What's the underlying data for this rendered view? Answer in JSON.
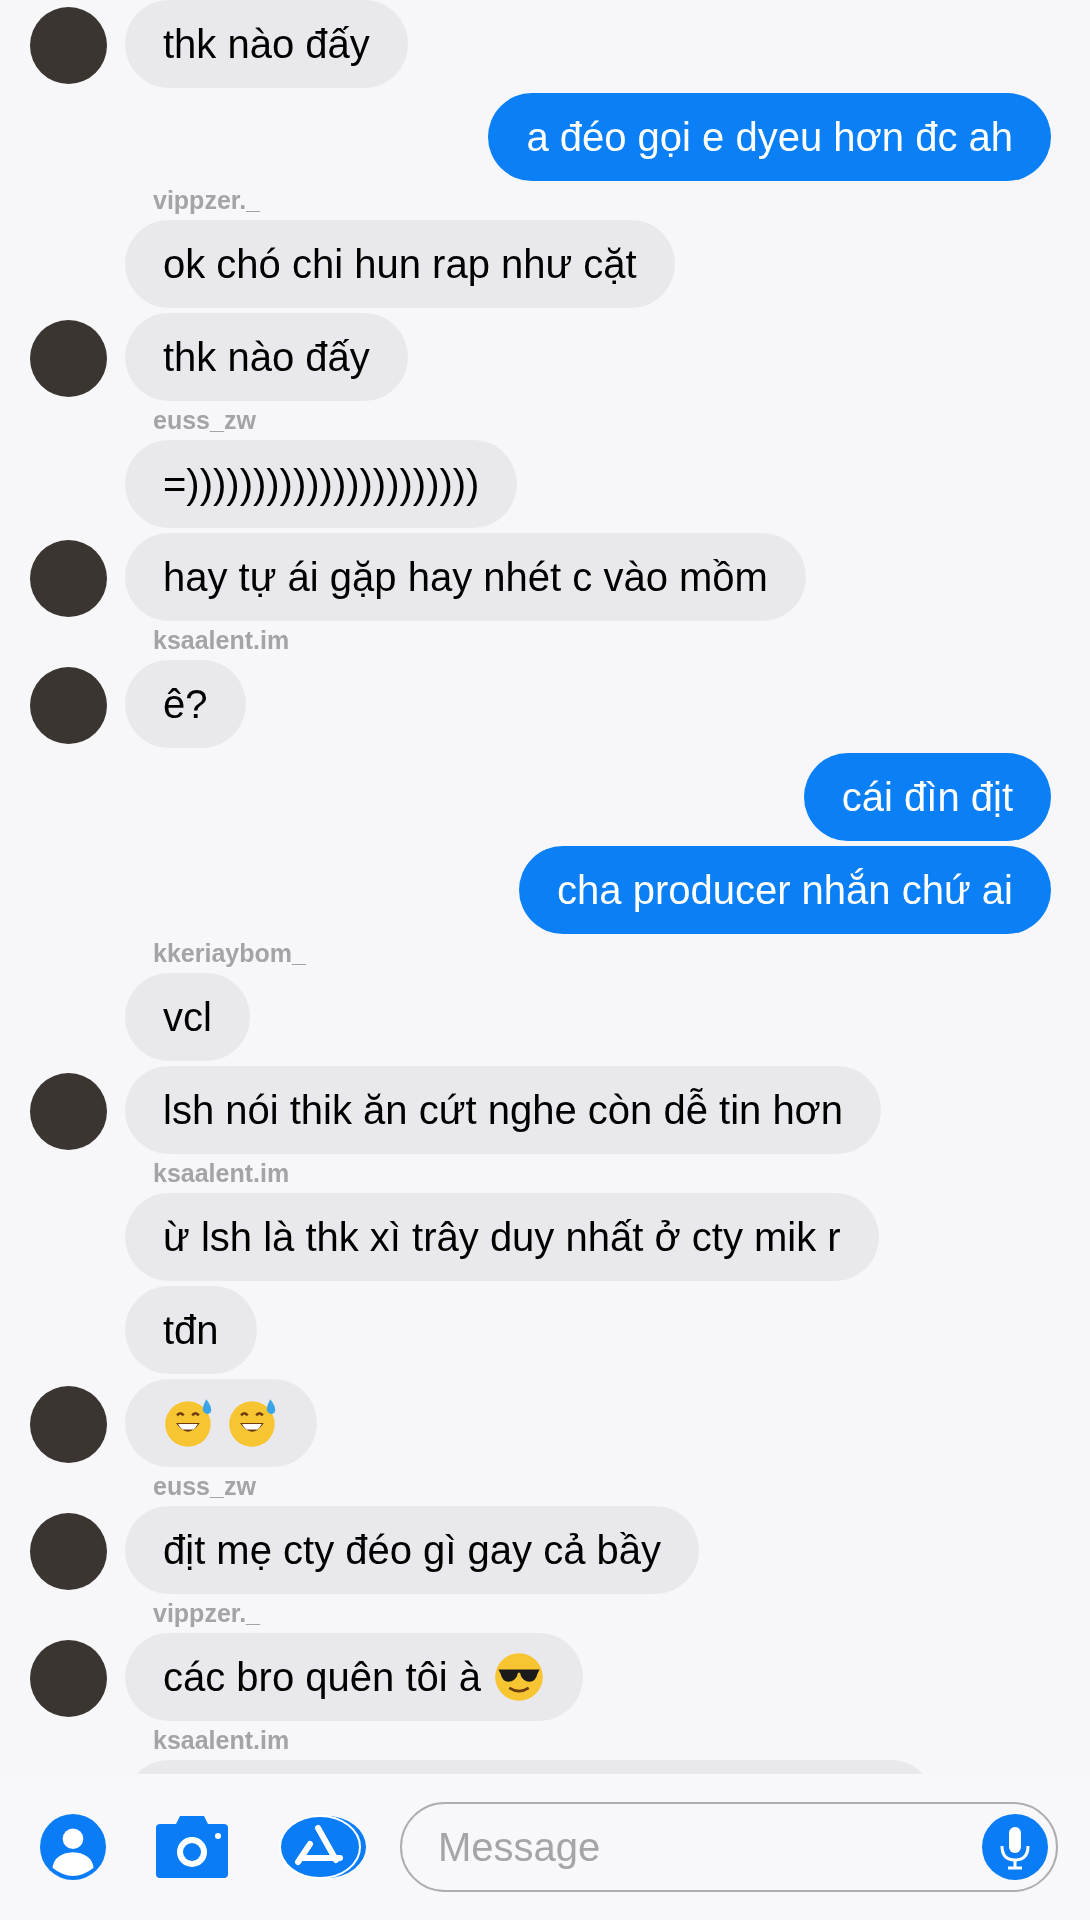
{
  "messages": [
    {
      "kind": "incoming",
      "avatar": true,
      "text": "thk nào đấy"
    },
    {
      "kind": "outgoing",
      "text": "a đéo gọi e dyeu hơn đc ah"
    },
    {
      "kind": "incoming",
      "sender": "vippzer._",
      "avatar": false,
      "text": "ok chó chi hun rap như cặt"
    },
    {
      "kind": "incoming",
      "avatar": true,
      "text": "thk nào đấy"
    },
    {
      "kind": "incoming",
      "sender": "euss_zw",
      "avatar": false,
      "text": "=))))))))))))))))))))))"
    },
    {
      "kind": "incoming",
      "avatar": true,
      "text": "hay tự ái gặp hay nhét c vào mồm"
    },
    {
      "kind": "incoming",
      "sender": "ksaalent.im",
      "avatar": true,
      "text": "ê?"
    },
    {
      "kind": "outgoing",
      "text": "cái đìn địt"
    },
    {
      "kind": "outgoing",
      "text": "cha producer nhắn chứ ai"
    },
    {
      "kind": "incoming",
      "sender": "kkeriaybom_",
      "avatar": false,
      "text": "vcl"
    },
    {
      "kind": "incoming",
      "avatar": true,
      "text": "lsh nói thik ăn cứt nghe còn dễ tin hơn"
    },
    {
      "kind": "incoming",
      "sender": "ksaalent.im",
      "avatar": false,
      "text": "ừ lsh là thk xì trây duy nhất ở cty mik r"
    },
    {
      "kind": "incoming",
      "avatar": false,
      "text": "tđn"
    },
    {
      "kind": "incoming",
      "avatar": true,
      "emoji": [
        {
          "kind": "sweat-smile"
        },
        {
          "kind": "sweat-smile"
        }
      ]
    },
    {
      "kind": "incoming",
      "sender": "euss_zw",
      "avatar": true,
      "text": "địt mẹ cty đéo gì gay cả bầy"
    },
    {
      "kind": "incoming",
      "sender": "vippzer._",
      "avatar": true,
      "text": "các bro quên tôi à",
      "emoji": [
        {
          "kind": "sunglasses"
        }
      ]
    },
    {
      "kind": "covered",
      "sender": "ksaalent.im",
      "avatar": false
    }
  ],
  "composer": {
    "placeholder": "Message"
  }
}
